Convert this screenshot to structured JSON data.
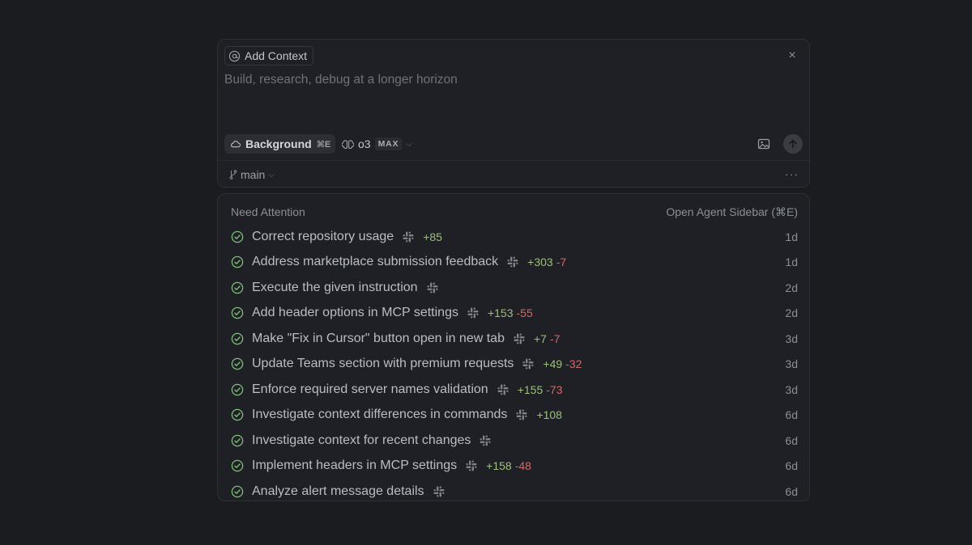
{
  "composer": {
    "add_context_label": "Add Context",
    "placeholder": "Build, research, debug at a longer horizon",
    "mode_label": "Background",
    "mode_shortcut": "⌘E",
    "model_name": "o3",
    "model_badge": "MAX",
    "branch": "main",
    "more_label": "···",
    "close_label": "×"
  },
  "attention": {
    "heading": "Need Attention",
    "sidebar_link": "Open Agent Sidebar (⌘E)",
    "items": [
      {
        "title": "Correct repository usage",
        "additions": "+85",
        "deletions": "",
        "age": "1d"
      },
      {
        "title": "Address marketplace submission feedback",
        "additions": "+303",
        "deletions": "-7",
        "age": "1d"
      },
      {
        "title": "Execute the given instruction",
        "additions": "",
        "deletions": "",
        "age": "2d"
      },
      {
        "title": "Add header options in MCP settings",
        "additions": "+153",
        "deletions": "-55",
        "age": "2d"
      },
      {
        "title": "Make \"Fix in Cursor\" button open in new tab",
        "additions": "+7",
        "deletions": "-7",
        "age": "3d"
      },
      {
        "title": "Update Teams section with premium requests",
        "additions": "+49",
        "deletions": "-32",
        "age": "3d"
      },
      {
        "title": "Enforce required server names validation",
        "additions": "+155",
        "deletions": "-73",
        "age": "3d"
      },
      {
        "title": "Investigate context differences in commands",
        "additions": "+108",
        "deletions": "",
        "age": "6d"
      },
      {
        "title": "Investigate context for recent changes",
        "additions": "",
        "deletions": "",
        "age": "6d"
      },
      {
        "title": "Implement headers in MCP settings",
        "additions": "+158",
        "deletions": "-48",
        "age": "6d"
      },
      {
        "title": "Analyze alert message details",
        "additions": "",
        "deletions": "",
        "age": "6d"
      }
    ]
  },
  "colors": {
    "background": "#1b1c20",
    "panel": "#1f2025",
    "addition": "#9fbf7c",
    "deletion": "#d06a6a",
    "check": "#7fbf7a"
  }
}
